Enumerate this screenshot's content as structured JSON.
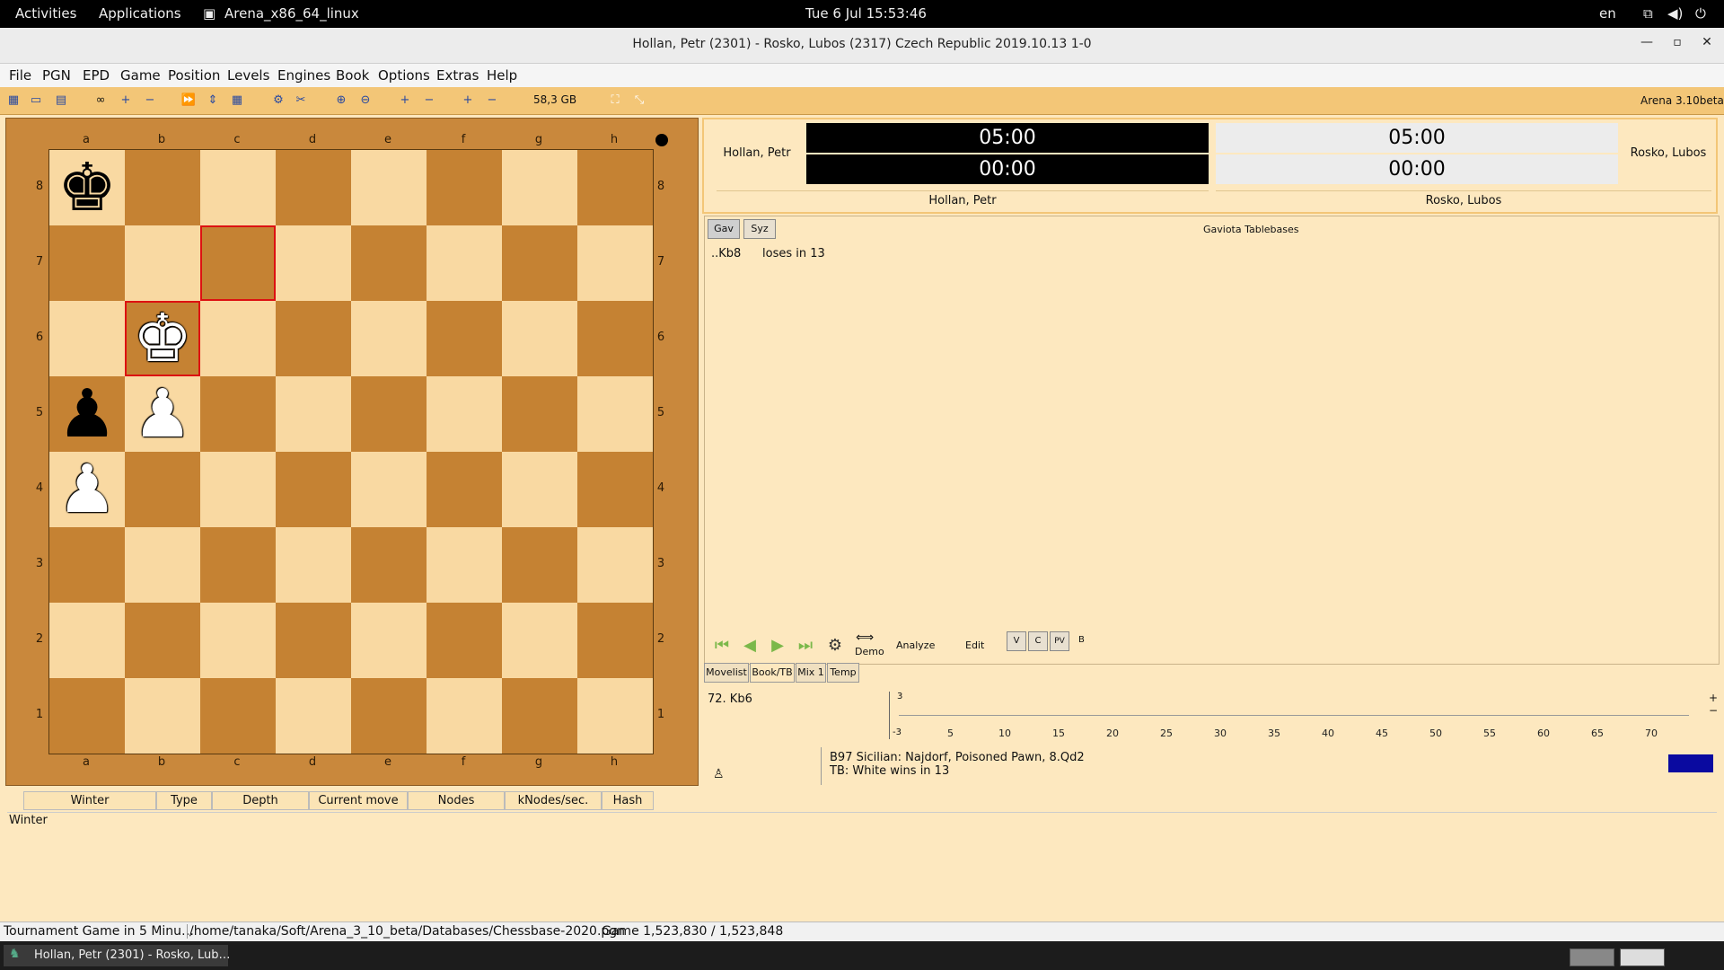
{
  "topbar": {
    "activities": "Activities",
    "applications": "Applications",
    "app_name": "Arena_x86_64_linux",
    "clock": "Tue 6 Jul  15:53:46",
    "lang": "en"
  },
  "window": {
    "title": "Hollan, Petr (2301)  -  Rosko, Lubos (2317)     Czech Republic     2019.10.13     1-0"
  },
  "menu": [
    "File",
    "PGN",
    "EPD",
    "Game",
    "Position",
    "Levels",
    "Engines",
    "Book",
    "Options",
    "Extras",
    "Help"
  ],
  "toolbar": {
    "disk": "58,3 GB",
    "version": "Arena 3.10beta"
  },
  "board": {
    "files": [
      "a",
      "b",
      "c",
      "d",
      "e",
      "f",
      "g",
      "h"
    ],
    "ranks": [
      "8",
      "7",
      "6",
      "5",
      "4",
      "3",
      "2",
      "1"
    ]
  },
  "clock": {
    "white_name": "Hollan, Petr",
    "black_name": "Rosko, Lubos",
    "white_time": "05:00",
    "white_sub": "00:00",
    "black_time": "05:00",
    "black_sub": "00:00",
    "white_footer": "Hollan, Petr",
    "black_footer": "Rosko, Lubos"
  },
  "tablebase": {
    "btn_gav": "Gav",
    "btn_syz": "Syz",
    "title": "Gaviota Tablebases",
    "move": "..Kb8",
    "result": "loses in 13"
  },
  "controls": {
    "demo": "Demo",
    "analyze": "Analyze",
    "edit": "Edit",
    "v": "V",
    "c": "C",
    "pv": "PV",
    "b": "B"
  },
  "tabs": [
    "Movelist",
    "Book/TB",
    "Mix 1",
    "Temp"
  ],
  "graph": {
    "current_move": "72. Kb6",
    "ymax": "3",
    "ymin": "-3",
    "xlabels": [
      "5",
      "10",
      "15",
      "20",
      "25",
      "30",
      "35",
      "40",
      "45",
      "50",
      "55",
      "60",
      "65",
      "70"
    ]
  },
  "opening": {
    "line1": "B97   Sicilian: Najdorf, Poisoned Pawn, 8.Qd2",
    "line2": "TB: White wins in 13"
  },
  "engine": {
    "headers": [
      "Winter",
      "Type",
      "Depth",
      "Current move",
      "Nodes",
      "kNodes/sec.",
      "Hash"
    ],
    "name": "Winter"
  },
  "status": {
    "mode": "Tournament Game in 5 Minu…",
    "path": "/home/tanaka/Soft/Arena_3_10_beta/Databases/Chessbase-2020.pgn",
    "game": "Game 1,523,830 / 1,523,848"
  },
  "taskbar": {
    "item": "Hollan, Petr (2301)  -  Rosko, Lub…"
  }
}
